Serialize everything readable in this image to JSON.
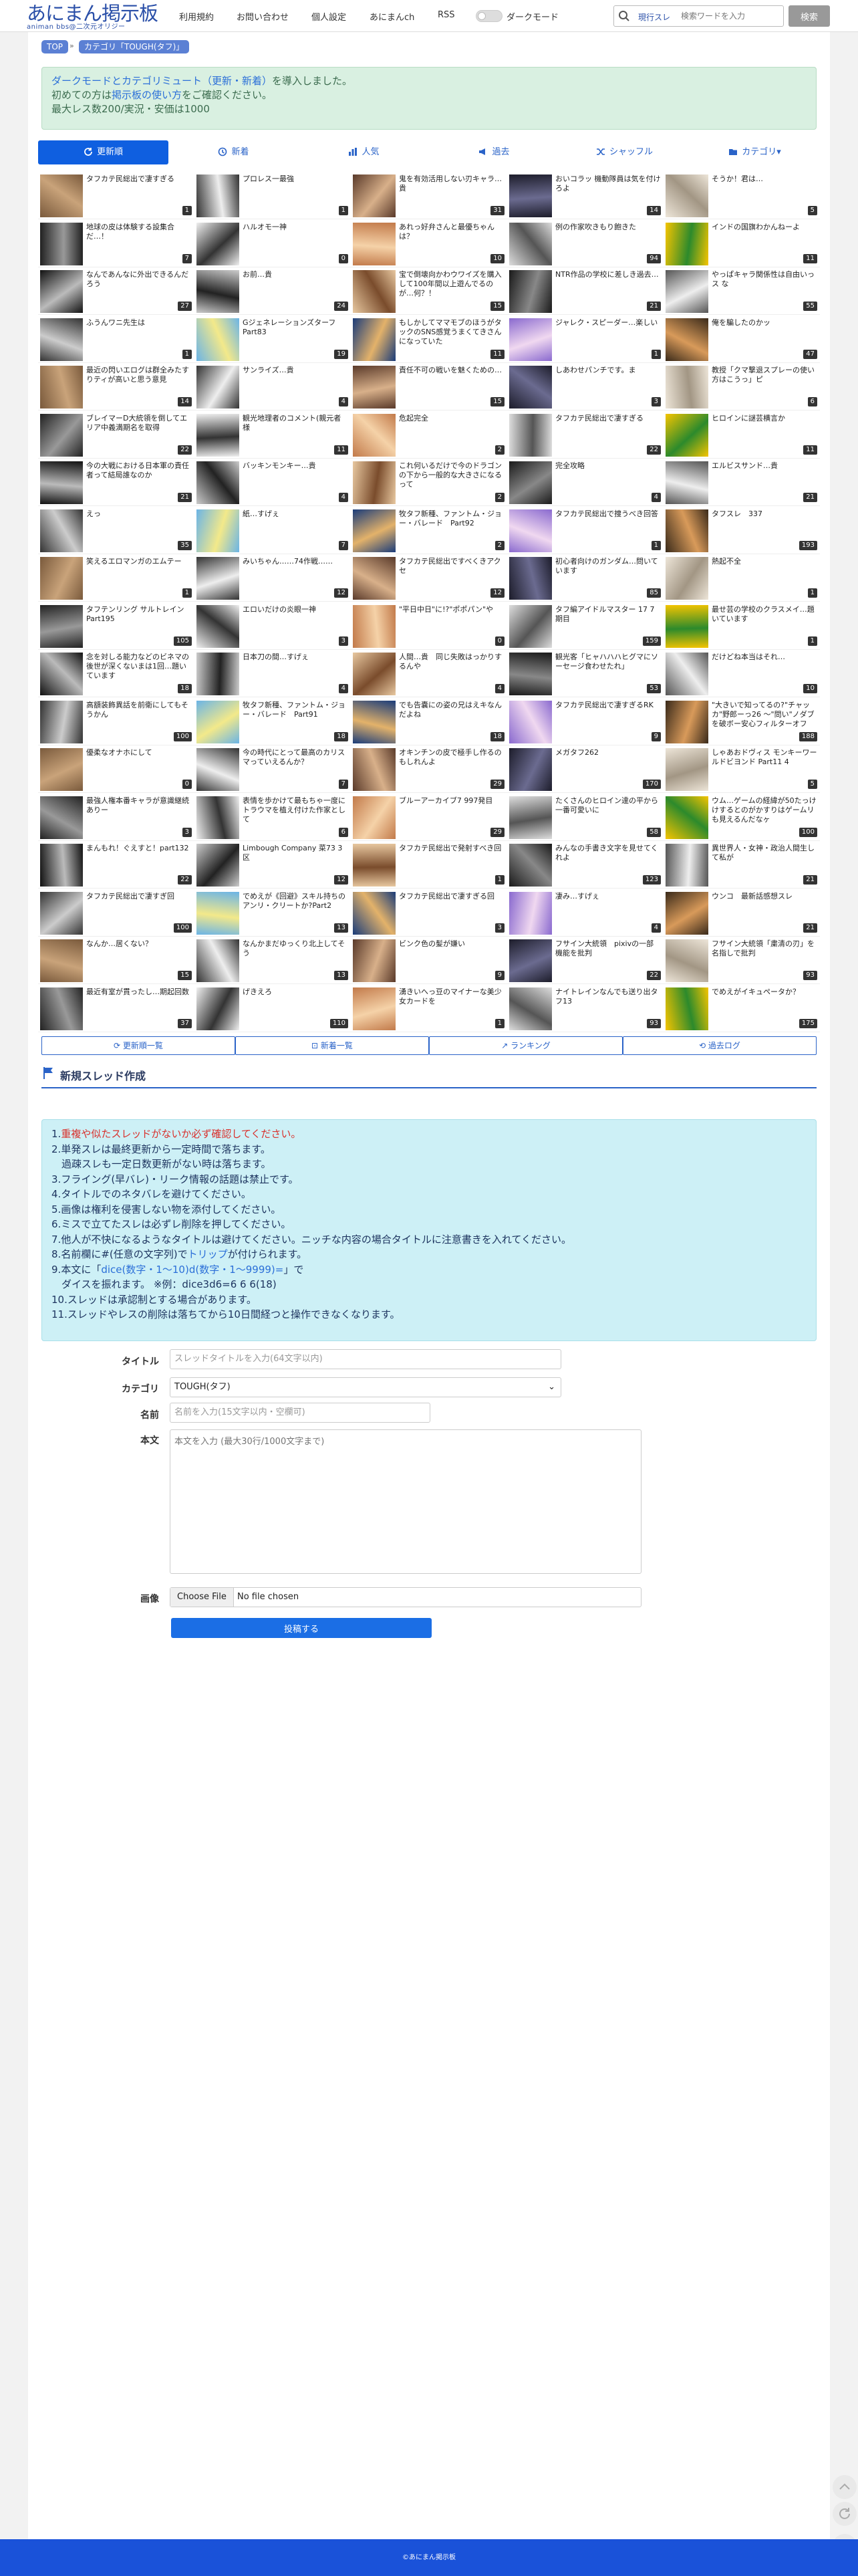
{
  "header": {
    "logo_title": "あにまん掲示板",
    "logo_sub": "animan bbs@二次元オリジー",
    "nav": [
      "利用規約",
      "お問い合わせ",
      "個人設定",
      "あにまんch",
      "RSS"
    ],
    "dark_mode_label": "ダークモード",
    "search_mode": "現行スレ",
    "search_placeholder": "検索ワードを入力",
    "search_button": "検索"
  },
  "breadcrumb": [
    "TOP",
    "カテゴリ「TOUGH(タフ)」"
  ],
  "notice": {
    "line1_link": "ダークモードとカテゴリミュート（更新・新着）",
    "line1_rest": "を導入しました。",
    "line2_pre": "初めての方は",
    "line2_link": "掲示板の使い方",
    "line2_post": "をご確認ください。",
    "line3": "最大レス数200/実況・安価は1000"
  },
  "tabs": [
    "更新順",
    "新着",
    "人気",
    "過去",
    "シャッフル",
    "カテゴリ▾"
  ],
  "threads": [
    {
      "title": "タフカテ民総出で凄すぎる",
      "count": "1",
      "img": 0
    },
    {
      "title": "プロレス一最強",
      "count": "1",
      "img": 1
    },
    {
      "title": "鬼を有効活用しない刃キャラ…貴",
      "count": "31",
      "img": 2
    },
    {
      "title": "おいコラッ 機動隊員は気を付けろよ",
      "count": "14",
      "img": 3
    },
    {
      "title": "そうか！君は…",
      "count": "5",
      "img": 4
    },
    {
      "title": "地球の皮は体験する設集合だ…！",
      "count": "7",
      "img": 5
    },
    {
      "title": "ハルオモ一神",
      "count": "0",
      "img": 6
    },
    {
      "title": "あれっ好弁さんと最優ちゃんは？",
      "count": "10",
      "img": 7
    },
    {
      "title": "例の作家吹きもり飽きた",
      "count": "94",
      "img": 8
    },
    {
      "title": "インドの国旗わかんねーよ",
      "count": "11",
      "img": 9
    },
    {
      "title": "なんであんなに外出できるんだろう",
      "count": "27",
      "img": 10
    },
    {
      "title": "お前…貴",
      "count": "24",
      "img": 11
    },
    {
      "title": "宝で倒壊向かわウワイズを購入して100年間以上遊んでるのが…何？！",
      "count": "15",
      "img": 12
    },
    {
      "title": "NTR作品の学校に差しき過去…",
      "count": "21",
      "img": 13
    },
    {
      "title": "やっぱキャラ関係性は自由いっス な",
      "count": "55",
      "img": 14
    },
    {
      "title": "ふうんワニ先生は",
      "count": "1",
      "img": 15
    },
    {
      "title": "Gジェネレーションズターフ Part83",
      "count": "19",
      "img": 16
    },
    {
      "title": "もしかしてママモブのほうがタックのSNS感覚うまくてきさんになっていた",
      "count": "11",
      "img": 17
    },
    {
      "title": "ジャレク・スピーダー…楽しい",
      "count": "1",
      "img": 18
    },
    {
      "title": "俺を騙したのかッ",
      "count": "47",
      "img": 19
    },
    {
      "title": "最近の閃いエログは群全みたすりティが高いと思う意見",
      "count": "14",
      "img": 20
    },
    {
      "title": "サンライズ…貴",
      "count": "4",
      "img": 21
    },
    {
      "title": "責任不可の戦いを魅くための…",
      "count": "15",
      "img": 22
    },
    {
      "title": "しあわせパンチです。ま",
      "count": "3",
      "img": 23
    },
    {
      "title": "教授「クマ撃退スプレーの使い方はこうっ」ピ",
      "count": "6",
      "img": 24
    },
    {
      "title": "ブレイマーD大統領を倒してエリア中義満期名を取得",
      "count": "22",
      "img": 25
    },
    {
      "title": "観光地理者のコメント(親元者様",
      "count": "11",
      "img": 26
    },
    {
      "title": "危起完全",
      "count": "2",
      "img": 27
    },
    {
      "title": "タフカテ民総出で凄すぎる",
      "count": "22",
      "img": 28
    },
    {
      "title": "ヒロインに謎芸横言か",
      "count": "11",
      "img": 29
    },
    {
      "title": "今の大戦における日本軍の責任者って結局誰なのか",
      "count": "21",
      "img": 30
    },
    {
      "title": "バッキンモンキー…貴",
      "count": "4",
      "img": 31
    },
    {
      "title": "これ何いるだけで今のドラゴンの下から一般的な大きさになるって",
      "count": "2",
      "img": 32
    },
    {
      "title": "完全攻略",
      "count": "4",
      "img": 33
    },
    {
      "title": "エルビスサンド…貴",
      "count": "21",
      "img": 34
    },
    {
      "title": "えっ",
      "count": "35",
      "img": 35
    },
    {
      "title": "紙…すげぇ",
      "count": "7",
      "img": 36
    },
    {
      "title": "牧タフ新種、ファントム・ジョー・バレード　Part92",
      "count": "2",
      "img": 37
    },
    {
      "title": "タフカテ民総出で捜うべき回答",
      "count": "1",
      "img": 38
    },
    {
      "title": "タフスレ　337",
      "count": "193",
      "img": 39
    },
    {
      "title": "笑えるエロマンガのエムテー",
      "count": "1",
      "img": 40
    },
    {
      "title": "みいちゃん……74作戦……",
      "count": "12",
      "img": 41
    },
    {
      "title": "タフカテ民総出ですべくきアクセ",
      "count": "12",
      "img": 42
    },
    {
      "title": "初心者向けのガンダム…問いています",
      "count": "85",
      "img": 43
    },
    {
      "title": "熱起不全",
      "count": "1",
      "img": 44
    },
    {
      "title": "タフテンリング サルトレイン Part195",
      "count": "105",
      "img": 45
    },
    {
      "title": "エロいだけの炎眼一神",
      "count": "3",
      "img": 46
    },
    {
      "title": "\"平日中日\"に!?\"ポポパン\"や",
      "count": "0",
      "img": 47
    },
    {
      "title": "タフ編アイドルマスター 17  7期目",
      "count": "159",
      "img": 48
    },
    {
      "title": "最せ芸の学校のクラスメイ…題いています",
      "count": "1",
      "img": 49
    },
    {
      "title": "念を対しる能力などのビネマの後世が深くないまは1回…題いています",
      "count": "18",
      "img": 50
    },
    {
      "title": "日本刀の間…すげぇ",
      "count": "4",
      "img": 51
    },
    {
      "title": "人間…貴　同じ失敗はっかりするんや",
      "count": "4",
      "img": 52
    },
    {
      "title": "観光客「ヒャハハハヒグマにソーセージ食わせたれ」",
      "count": "53",
      "img": 53
    },
    {
      "title": "だけどね本当はそれ…",
      "count": "10",
      "img": 54
    },
    {
      "title": "高額装飾異話を前衛にしてもそうかん",
      "count": "100",
      "img": 55
    },
    {
      "title": "牧タフ新種、ファントム・ジョー・バレード　Part91",
      "count": "18",
      "img": 56
    },
    {
      "title": "でも告嚢にの姿の兄はえキなんだよね",
      "count": "18",
      "img": 57
    },
    {
      "title": "タフカテ民総出で凄すぎるRK",
      "count": "9",
      "img": 58
    },
    {
      "title": "\"大きいで知ってるの?\"チャッカ\"野郎ーっ26 〜\"問い\"ノダブを破ボー安心フィルターオフ",
      "count": "188",
      "img": 59
    },
    {
      "title": "優柔なオナホにして",
      "count": "0",
      "img": 60
    },
    {
      "title": "今の時代にとって最高のカリスマっていえるんか？",
      "count": "7",
      "img": 61
    },
    {
      "title": "オキンチンの皮で極手し作るのもしれんよ",
      "count": "29",
      "img": 62
    },
    {
      "title": "メガタフ262",
      "count": "170",
      "img": 63
    },
    {
      "title": "しゃあおドヴィス モンキーワールドビヨンド Part11 4",
      "count": "5",
      "img": 64
    },
    {
      "title": "最強人権本番キャラが意識継続ありー",
      "count": "3",
      "img": 65
    },
    {
      "title": "表情を歩かけて最もちゃ一度にトラウマを植え付けた作家として",
      "count": "6",
      "img": 66
    },
    {
      "title": "ブルーアーカイブ7  997発目",
      "count": "29",
      "img": 67
    },
    {
      "title": "たくさんのヒロイン達の平から一番可愛いに",
      "count": "58",
      "img": 68
    },
    {
      "title": "ウム…ゲームの経緯が50たっけけするとのがかすりはゲームリも見えるんだなヶ",
      "count": "100",
      "img": 69
    },
    {
      "title": "まんもれ！ぐえすと！part132",
      "count": "22",
      "img": 70
    },
    {
      "title": "Limbough Company 菜73 3区",
      "count": "12",
      "img": 71
    },
    {
      "title": "タフカテ民総出で発射すべき回",
      "count": "1",
      "img": 72
    },
    {
      "title": "みんなの手書き文字を見せてくれよ",
      "count": "123",
      "img": 73
    },
    {
      "title": "異世界人・女神・政治人間生して私が",
      "count": "21",
      "img": 74
    },
    {
      "title": "タフカテ民総出で凄すぎ回",
      "count": "100",
      "img": 75
    },
    {
      "title": "でめえが《回避》スキル持ちのアンリ・クリートか?Part2",
      "count": "13",
      "img": 76
    },
    {
      "title": "タフカテ民総出で凄すぎる回",
      "count": "3",
      "img": 77
    },
    {
      "title": "凄み…すげぇ",
      "count": "4",
      "img": 78
    },
    {
      "title": "ウンコ　最新話感想スレ",
      "count": "21",
      "img": 79
    },
    {
      "title": "なんか…居くない？",
      "count": "15",
      "img": 80
    },
    {
      "title": "なんかまだゆっくり北上してそう",
      "count": "13",
      "img": 81
    },
    {
      "title": "ビンク色の髪が嫌い",
      "count": "9",
      "img": 82
    },
    {
      "title": "フサイン大統領　pixivの一部機能を批判",
      "count": "22",
      "img": 83
    },
    {
      "title": "フサイン大統領「粛清の刃」を名指しで批判",
      "count": "93",
      "img": 84
    },
    {
      "title": "最近有室が貫ったし…期起回数",
      "count": "37",
      "img": 85
    },
    {
      "title": "げきえろ",
      "count": "110",
      "img": 86
    },
    {
      "title": "湧きいへっ豆のマイナーな美少女カードを",
      "count": "1",
      "img": 87
    },
    {
      "title": "ナイトレインなんでも送り出タフ13",
      "count": "93",
      "img": 88
    },
    {
      "title": "でめえがイキュペータか？",
      "count": "175",
      "img": 89
    }
  ],
  "bottom_buttons": [
    "更新順一覧",
    "新着一覧",
    "ランキング",
    "過去ログ"
  ],
  "new_thread": {
    "heading": "新規スレッド作成",
    "rules": [
      {
        "num": "1.",
        "text": "重複や似たスレッドがないか必ず確認してください。",
        "style": "red"
      },
      {
        "num": "2.",
        "text": "単発スレは最終更新から一定時間で落ちます。",
        "style": ""
      },
      {
        "num": "",
        "text": "　過疎スレも一定日数更新がない時は落ちます。",
        "style": ""
      },
      {
        "num": "3.",
        "text": "フライング(早バレ)・リーク情報の話題は禁止です。",
        "style": ""
      },
      {
        "num": "4.",
        "text": "タイトルでのネタバレを避けてください。",
        "style": ""
      },
      {
        "num": "5.",
        "text": "画像は権利を侵害しない物を添付してください。",
        "style": ""
      },
      {
        "num": "6.",
        "text": "ミスで立てたスレは必ずレ削除を押してください。",
        "style": ""
      },
      {
        "num": "7.",
        "text": "他人が不快になるようなタイトルは避けてください。ニッチな内容の場合タイトルに注意書きを入れてください。",
        "style": ""
      },
      {
        "num": "8.",
        "text": "名前欄に#(任意の文字列)でトリップが付けられます。",
        "style": "trip"
      },
      {
        "num": "9.",
        "text": "本文に「dice(数字・1〜10)d(数字・1〜9999)=」で",
        "style": "dice"
      },
      {
        "num": "",
        "text": "　ダイスを振れます。 ※例：dice3d6=6 6 6(18)",
        "style": ""
      },
      {
        "num": "10.",
        "text": "スレッドは承認制とする場合があります。",
        "style": ""
      },
      {
        "num": "11.",
        "text": "スレッドやレスの削除は落ちてから10日間経つと操作できなくなります。",
        "style": ""
      }
    ],
    "labels": {
      "title": "タイトル",
      "category": "カテゴリ",
      "name": "名前",
      "body": "本文",
      "image": "画像"
    },
    "title_placeholder": "スレッドタイトルを入力(64文字以内)",
    "category_value": "TOUGH(タフ)",
    "name_placeholder": "名前を入力(15文字以内・空欄可)",
    "body_placeholder": "本文を入力 (最大30行/1000文字まで)",
    "file_button": "Choose File",
    "file_status": "No file chosen",
    "submit": "投稿する"
  },
  "footer": "©あにまん掲示板",
  "colors": {
    "accent": "#0f5fe0",
    "brand": "#2a4fa8",
    "notice_bg": "#d9f0e1",
    "rules_bg": "#cdf0f6",
    "footer": "#1a52d9"
  }
}
